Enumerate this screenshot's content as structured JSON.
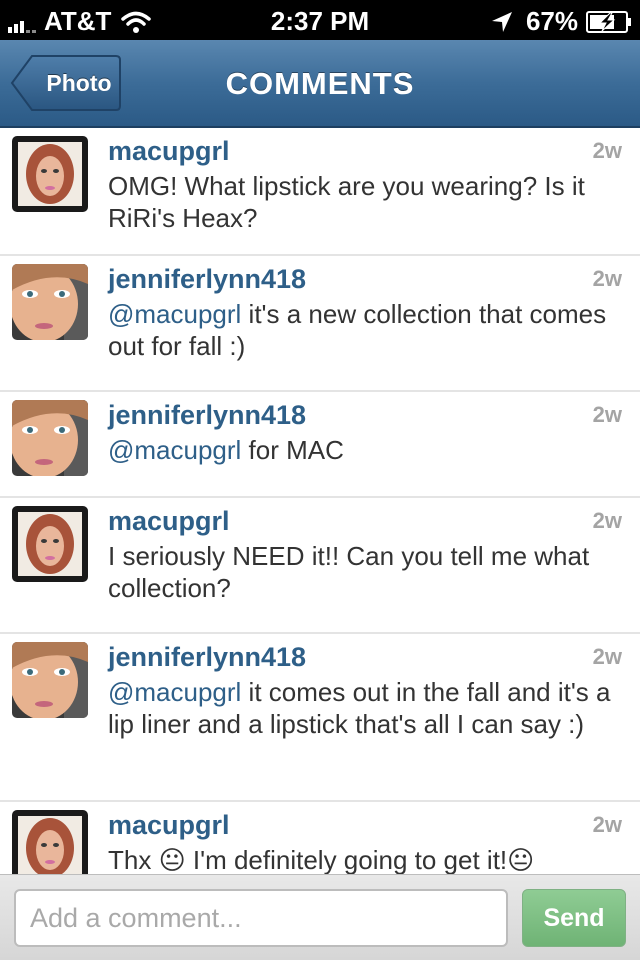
{
  "status_bar": {
    "carrier": "AT&T",
    "time": "2:37 PM",
    "battery": "67%"
  },
  "nav": {
    "back_label": "Photo",
    "title": "COMMENTS"
  },
  "comments": [
    {
      "username": "macupgrl",
      "time": "2w",
      "mention": "",
      "text": "OMG! What lipstick are you wearing? Is it RiRi's Heax?"
    },
    {
      "username": "jenniferlynn418",
      "time": "2w",
      "mention": "@macupgrl",
      "text": " it's a new collection that comes out for fall :)"
    },
    {
      "username": "jenniferlynn418",
      "time": "2w",
      "mention": "@macupgrl",
      "text": " for MAC"
    },
    {
      "username": "macupgrl",
      "time": "2w",
      "mention": "",
      "text": "I seriously NEED it!! Can you tell me what collection?"
    },
    {
      "username": "jenniferlynn418",
      "time": "2w",
      "mention": "@macupgrl",
      "text": " it comes out in the fall and it's a lip liner and a lipstick that's all I can say :)"
    },
    {
      "username": "macupgrl",
      "time": "2w",
      "mention": "",
      "text": "Thx 😐 I'm definitely going to get it!😐"
    }
  ],
  "input": {
    "placeholder": "Add a comment...",
    "send_label": "Send"
  },
  "colors": {
    "nav_blue": "#3c6c98",
    "username_blue": "#2e5f88",
    "send_green": "#7cbf82"
  }
}
